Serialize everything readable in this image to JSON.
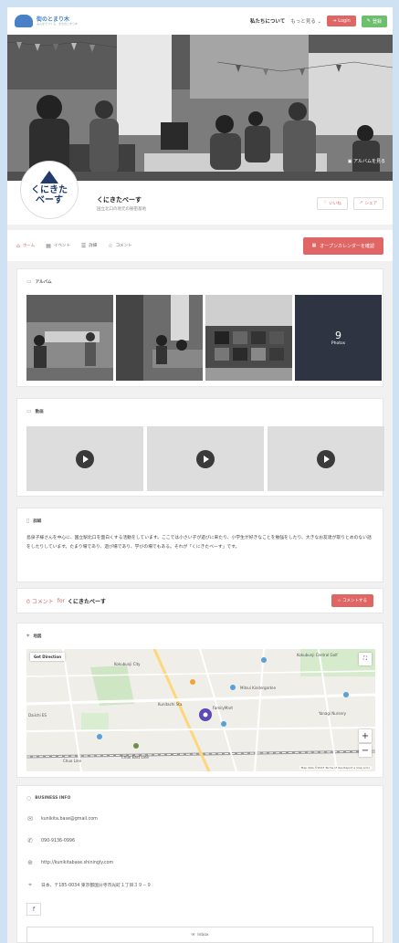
{
  "header": {
    "logo_text": "街のとまり木",
    "logo_sub": "みんなでつくる、まちのとまり木",
    "nav_about": "私たちについて",
    "nav_more": "もっと見る",
    "login_label": "Login",
    "register_label": "登録"
  },
  "hero": {
    "album_link": "アルバムを見る"
  },
  "profile": {
    "avatar_line1": "くにきた",
    "avatar_line2": "べーす",
    "name": "くにきたべーす",
    "subtitle": "国立北口の地元の秘密基地",
    "like_label": "いいね",
    "share_label": "シェア"
  },
  "tabs": [
    {
      "label": "ホーム",
      "icon": "home-icon"
    },
    {
      "label": "イベント",
      "icon": "calendar-icon"
    },
    {
      "label": "詳細",
      "icon": "list-icon"
    },
    {
      "label": "コメント",
      "icon": "star-icon"
    }
  ],
  "open_calendar_label": "オープンカレンダーを確認",
  "album": {
    "title": "アルバム",
    "more_count": "9",
    "more_label": "Photos"
  },
  "videos": {
    "title": "動画"
  },
  "detail": {
    "title": "詳細",
    "text": "島泉子様さんを中心に、国立駅北口を面白くする活動をしています。ここでは小さい子が遊びに来たり、小学生が好きなことを勉強をしたり、大きなお友達が取りとめのない話をしたりしています。たまり場であり、遊び場であり、学びの場でもある。それが「くにきたべーす」です。"
  },
  "comment": {
    "count": "0 コメント",
    "for": "for",
    "name": "くにきたべーす",
    "button": "コメントする"
  },
  "map": {
    "title": "地図",
    "get_direction": "Get Direction",
    "labels": {
      "kokubunji_city": "Kokubunji City",
      "kokubunji_central": "Kokubunji Central Golf",
      "family_mart": "FamilyMart",
      "mitsui": "Mitsui Kindergarten",
      "yanagi": "Yanagi Nursery",
      "kunitachi": "Kunitachi Sta.",
      "chuo_line": "Chuo Line",
      "chuo_east": "Chuo East Line",
      "daiichi": "Daiichi ES"
    },
    "footer": "Map data ©2023  Terms of Use  Report a map error"
  },
  "business": {
    "title": "BUSINESS INFO",
    "email": "kunikita.base@gmail.com",
    "phone": "090-9136-0996",
    "website": "http://kunikitabase.shiningly.com",
    "address": "日本、〒185-0034 東京都国分寺市光町１丁目３９－９",
    "facebook": "f",
    "inbox_label": "Inbox"
  }
}
